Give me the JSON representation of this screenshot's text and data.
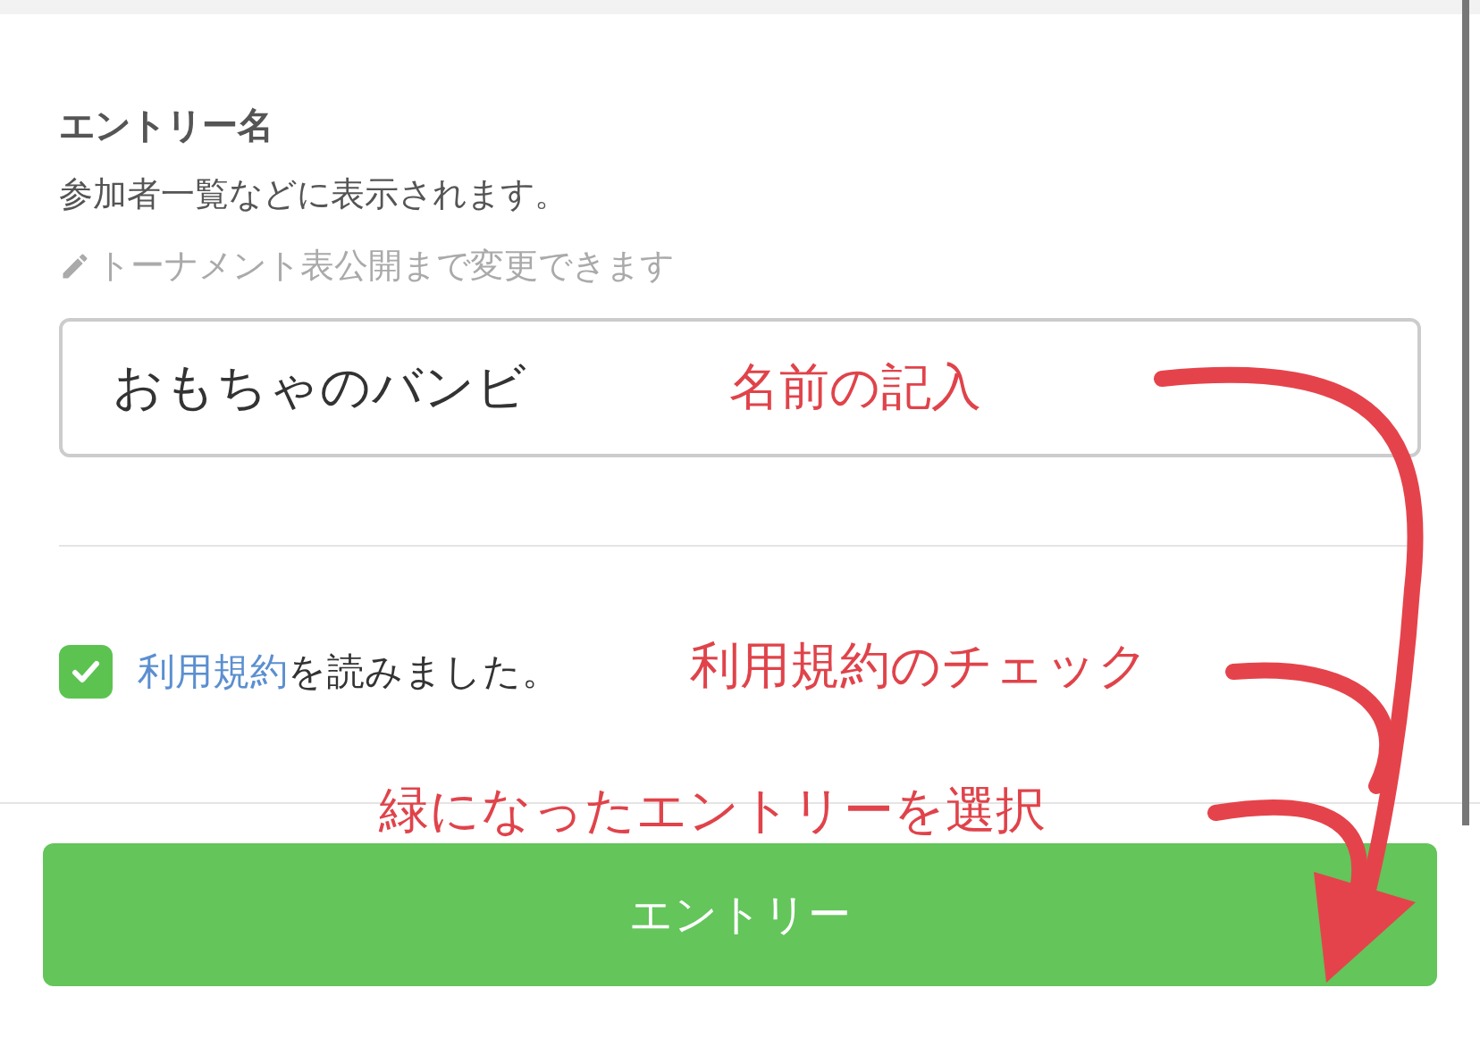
{
  "entry_name": {
    "label": "エントリー名",
    "description": "参加者一覧などに表示されます。",
    "hint": "トーナメント表公開まで変更できます",
    "value": "おもちゃのバンビ"
  },
  "terms": {
    "checked": true,
    "link": "利用規約",
    "text": "を読みました。"
  },
  "submit_button": {
    "label": "エントリー"
  },
  "annotations": [
    {
      "text": "名前の記入"
    },
    {
      "text": "利用規約のチェック"
    },
    {
      "text": "緑になったエントリーを選択"
    }
  ]
}
